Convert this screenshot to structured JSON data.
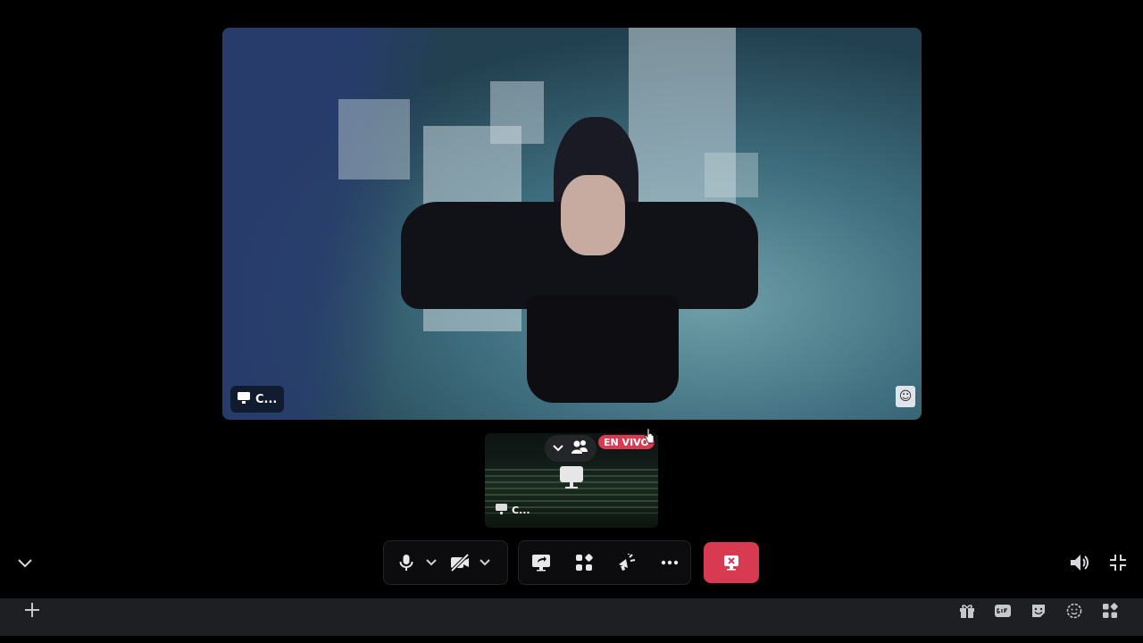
{
  "stream": {
    "tile_label": "C...",
    "thumbnail_label": "C...",
    "live_badge": "EN VIVO"
  },
  "colors": {
    "end_call": "#d83a52",
    "live_badge": "#d83a52",
    "toolbar_bg": "#0c0c0e",
    "chat_bar_bg": "#1e1f22"
  },
  "toolbar": {
    "groups": [
      [
        "microphone-icon",
        "chevron-down-icon",
        "camera-off-icon",
        "chevron-down-icon"
      ],
      [
        "screen-share-icon",
        "activities-icon",
        "soundboard-icon",
        "more-icon"
      ]
    ],
    "end_call_icon": "leave-stream-icon"
  },
  "chat_bar": {
    "icons": [
      "gift-icon",
      "gif-icon",
      "sticker-icon",
      "emoji-icon",
      "apps-icon"
    ]
  },
  "corner_icons": [
    "volume-icon",
    "collapse-icon"
  ]
}
